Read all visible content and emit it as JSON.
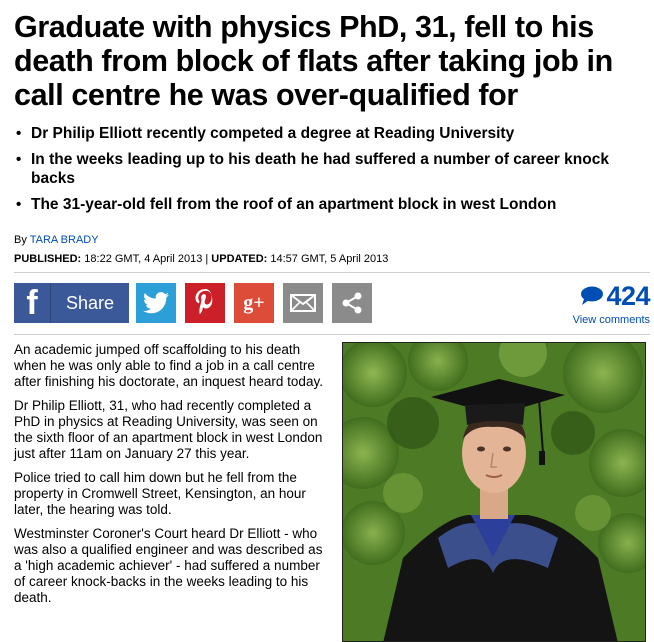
{
  "article": {
    "headline": "Graduate with physics PhD, 31, fell to his death from block of flats after taking job in call centre he was over-qualified for",
    "bullets": [
      "Dr Philip Elliott recently competed a degree at Reading University",
      "In the weeks leading up to his death he had suffered a number of career knock backs",
      "The 31-year-old fell from the roof of an apartment block in west London"
    ],
    "byline": {
      "prefix": "By",
      "author": "Tara Brady"
    },
    "dates": {
      "published_label": "PUBLISHED:",
      "published": "18:22 GMT, 4 April 2013",
      "separator": "|",
      "updated_label": "UPDATED:",
      "updated": "14:57 GMT, 5 April 2013"
    },
    "paragraphs": [
      "An academic jumped off scaffolding to his death when he was only able to find a job in a call centre after finishing his doctorate, an inquest heard today.",
      "Dr Philip Elliott, 31, who had recently completed a PhD in physics at Reading University, was seen on the sixth floor of an apartment block in west London just after 11am on January 27 this year.",
      "Police tried to call him down but he fell from the property in Cromwell Street, Kensington, an hour later, the hearing was told.",
      "Westminster Coroner's Court heard Dr Elliott - who was also a qualified engineer and was described as a 'high academic achiever' - had suffered a number of career knock-backs in the weeks leading to his death."
    ]
  },
  "share": {
    "facebook_letter": "f",
    "facebook_label": "Share",
    "googleplus_label": "g+",
    "icons": [
      "facebook-icon",
      "twitter-icon",
      "pinterest-icon",
      "google-plus-icon",
      "email-icon",
      "share-icon"
    ],
    "colors": {
      "facebook": "#3b5998",
      "twitter": "#2d9fd8",
      "pinterest": "#cb2027",
      "googleplus": "#dd4b39",
      "email": "#8b8b8b",
      "more": "#8b8b8b"
    }
  },
  "comments": {
    "count": "424",
    "view_label": "View comments",
    "icon": "comment-bubble-icon",
    "color": "#004db3"
  }
}
